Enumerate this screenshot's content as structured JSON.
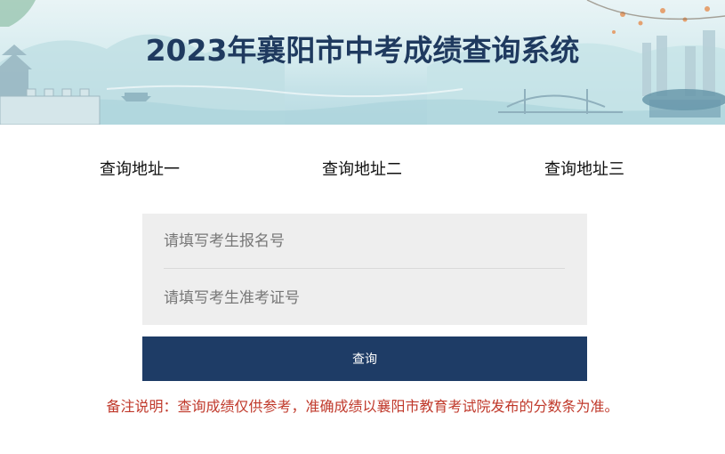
{
  "header": {
    "title": "2023年襄阳市中考成绩查询系统"
  },
  "links": [
    {
      "label": "查询地址一"
    },
    {
      "label": "查询地址二"
    },
    {
      "label": "查询地址三"
    }
  ],
  "form": {
    "registration_placeholder": "请填写考生报名号",
    "registration_value": "",
    "admission_placeholder": "请填写考生准考证号",
    "admission_value": "",
    "submit_label": "查询"
  },
  "note": "备注说明：查询成绩仅供参考，准确成绩以襄阳市教育考试院发布的分数条为准。",
  "colors": {
    "title": "#1f3a5f",
    "button": "#1e3c66",
    "note": "#c0392b",
    "form_bg": "#eeeeee"
  }
}
